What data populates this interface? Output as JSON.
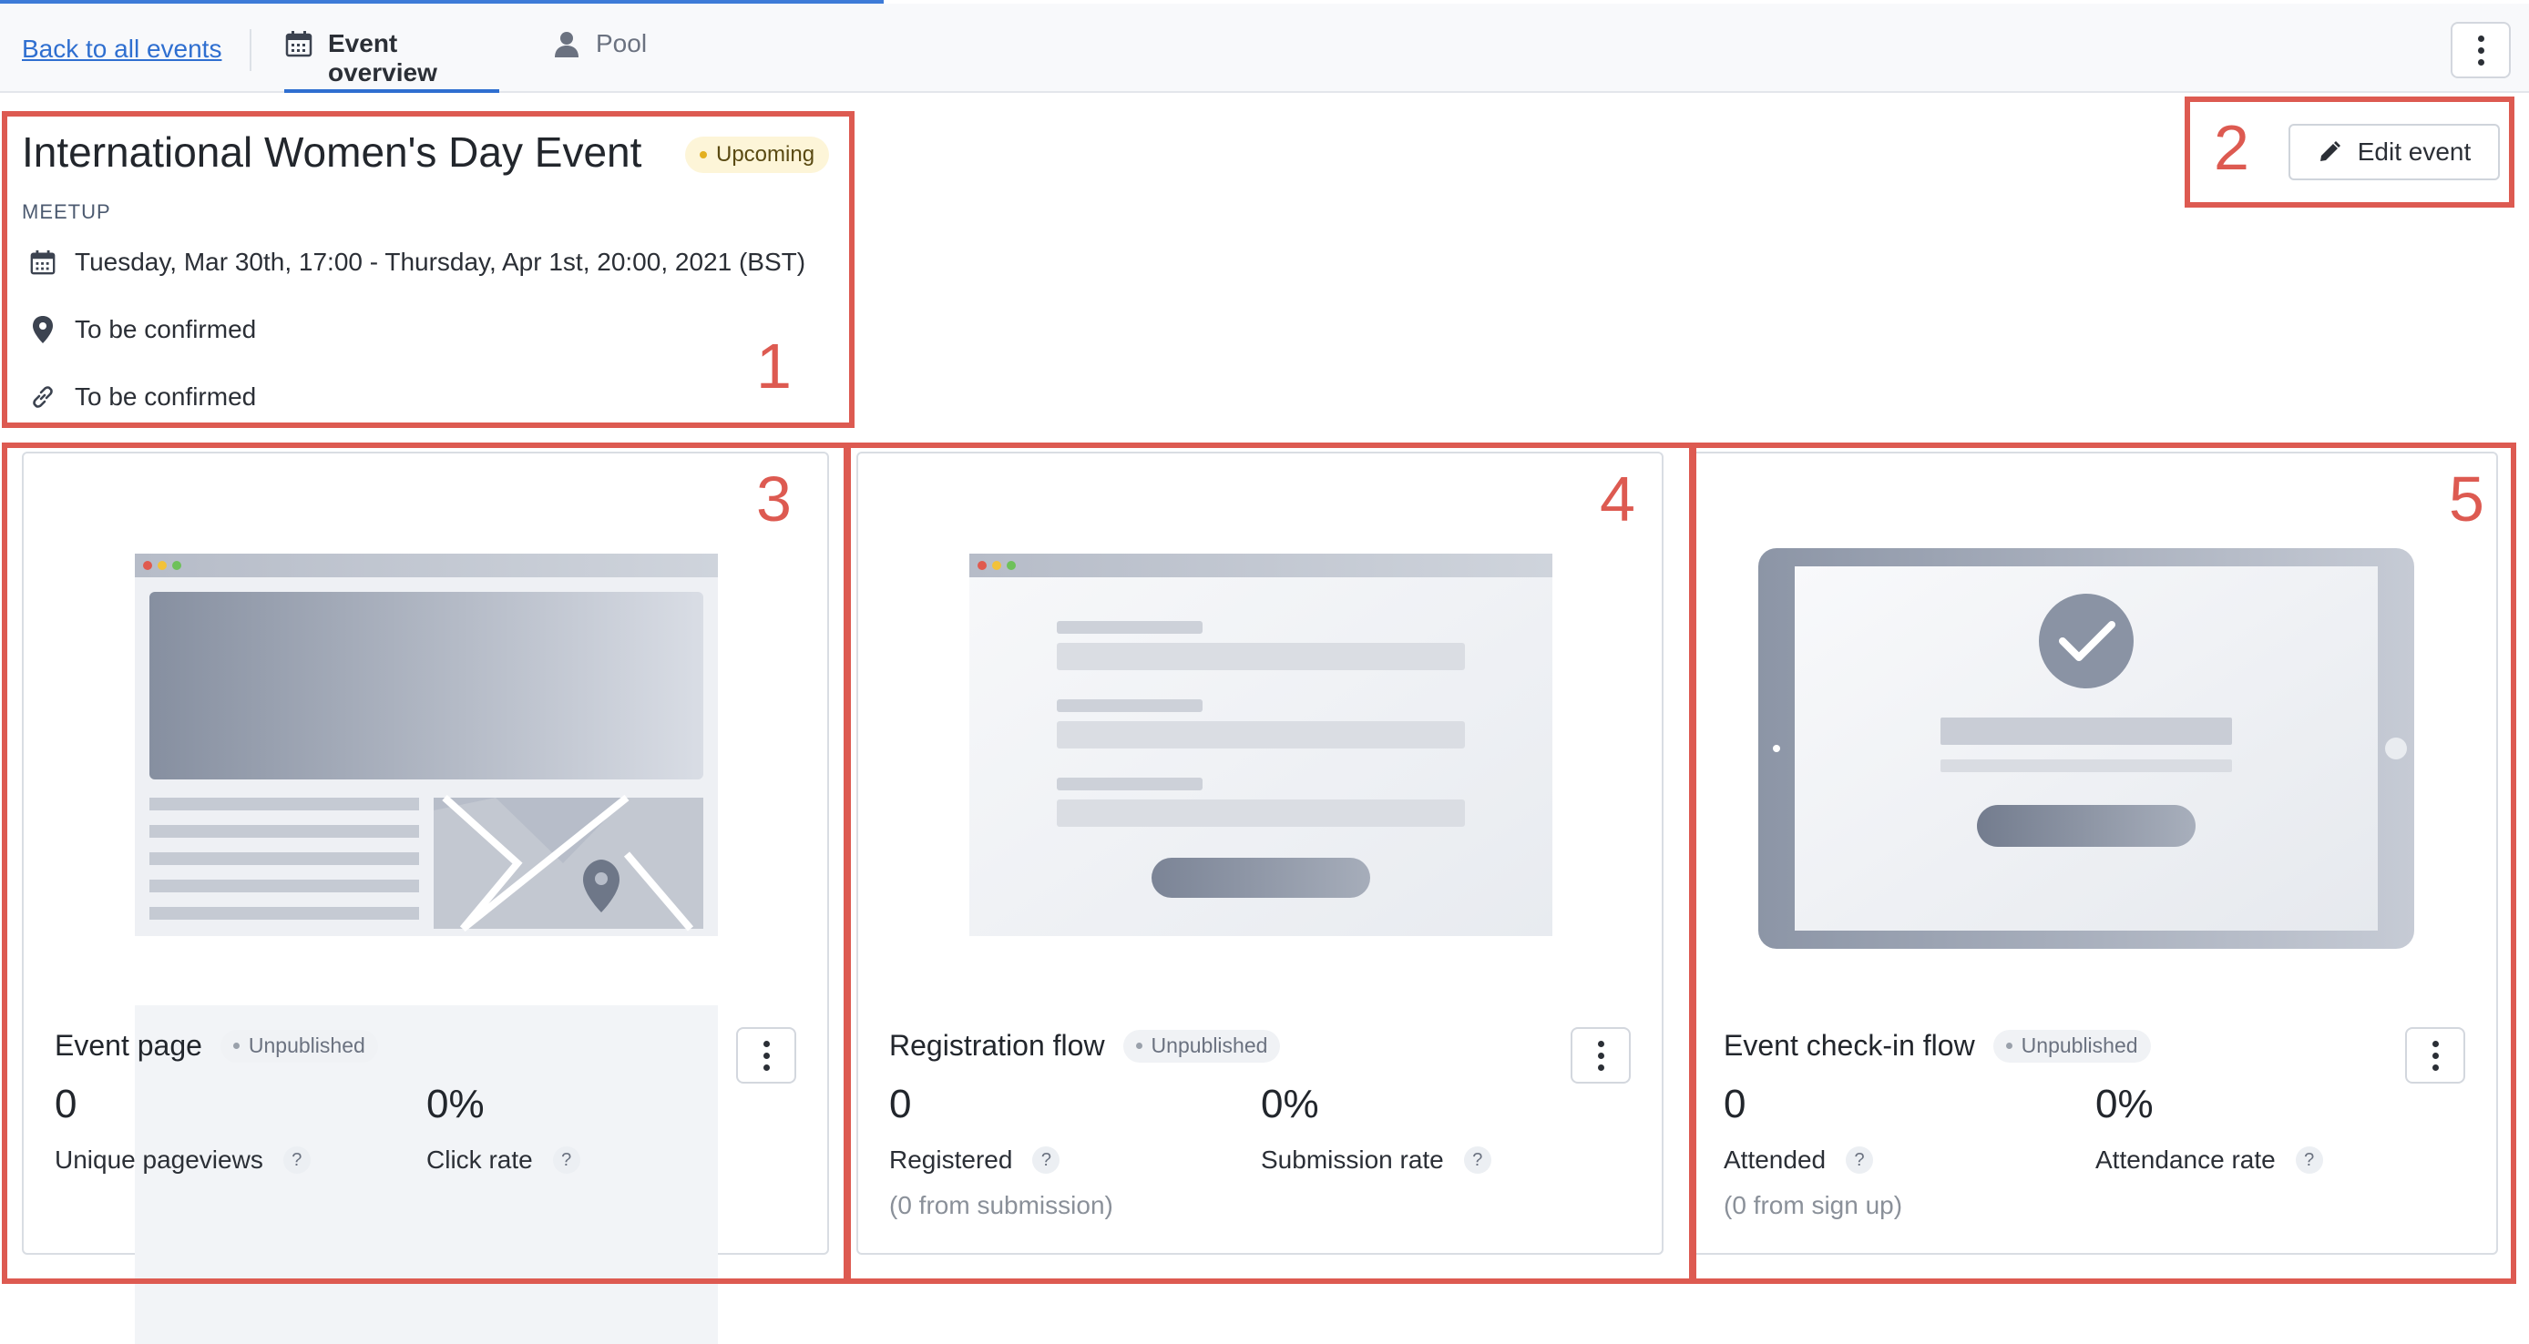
{
  "nav": {
    "back_label": "Back to all events",
    "tab_overview": "Event overview",
    "tab_pool": "Pool"
  },
  "event": {
    "title": "International Women's Day Event",
    "status": "Upcoming",
    "type": "MEETUP",
    "datetime": "Tuesday, Mar 30th, 17:00 - Thursday, Apr 1st, 20:00, 2021 (BST)",
    "location": "To be confirmed",
    "link": "To be confirmed"
  },
  "actions": {
    "edit_label": "Edit event"
  },
  "annotations": [
    "1",
    "2",
    "3",
    "4",
    "5"
  ],
  "cards": [
    {
      "title": "Event page",
      "status": "Unpublished",
      "metric1_value": "0",
      "metric1_label": "Unique pageviews",
      "metric2_value": "0%",
      "metric2_label": "Click rate"
    },
    {
      "title": "Registration flow",
      "status": "Unpublished",
      "metric1_value": "0",
      "metric1_label": "Registered",
      "metric1_sub": "(0 from submission)",
      "metric2_value": "0%",
      "metric2_label": "Submission rate"
    },
    {
      "title": "Event check-in flow",
      "status": "Unpublished",
      "metric1_value": "0",
      "metric1_label": "Attended",
      "metric1_sub": "(0 from sign up)",
      "metric2_value": "0%",
      "metric2_label": "Attendance rate"
    }
  ],
  "help_glyph": "?",
  "colors": {
    "accent": "#2f6fd0",
    "annotation": "#dd5a51",
    "upcoming_bg": "#fdf5d8",
    "upcoming_dot": "#e3b021"
  }
}
